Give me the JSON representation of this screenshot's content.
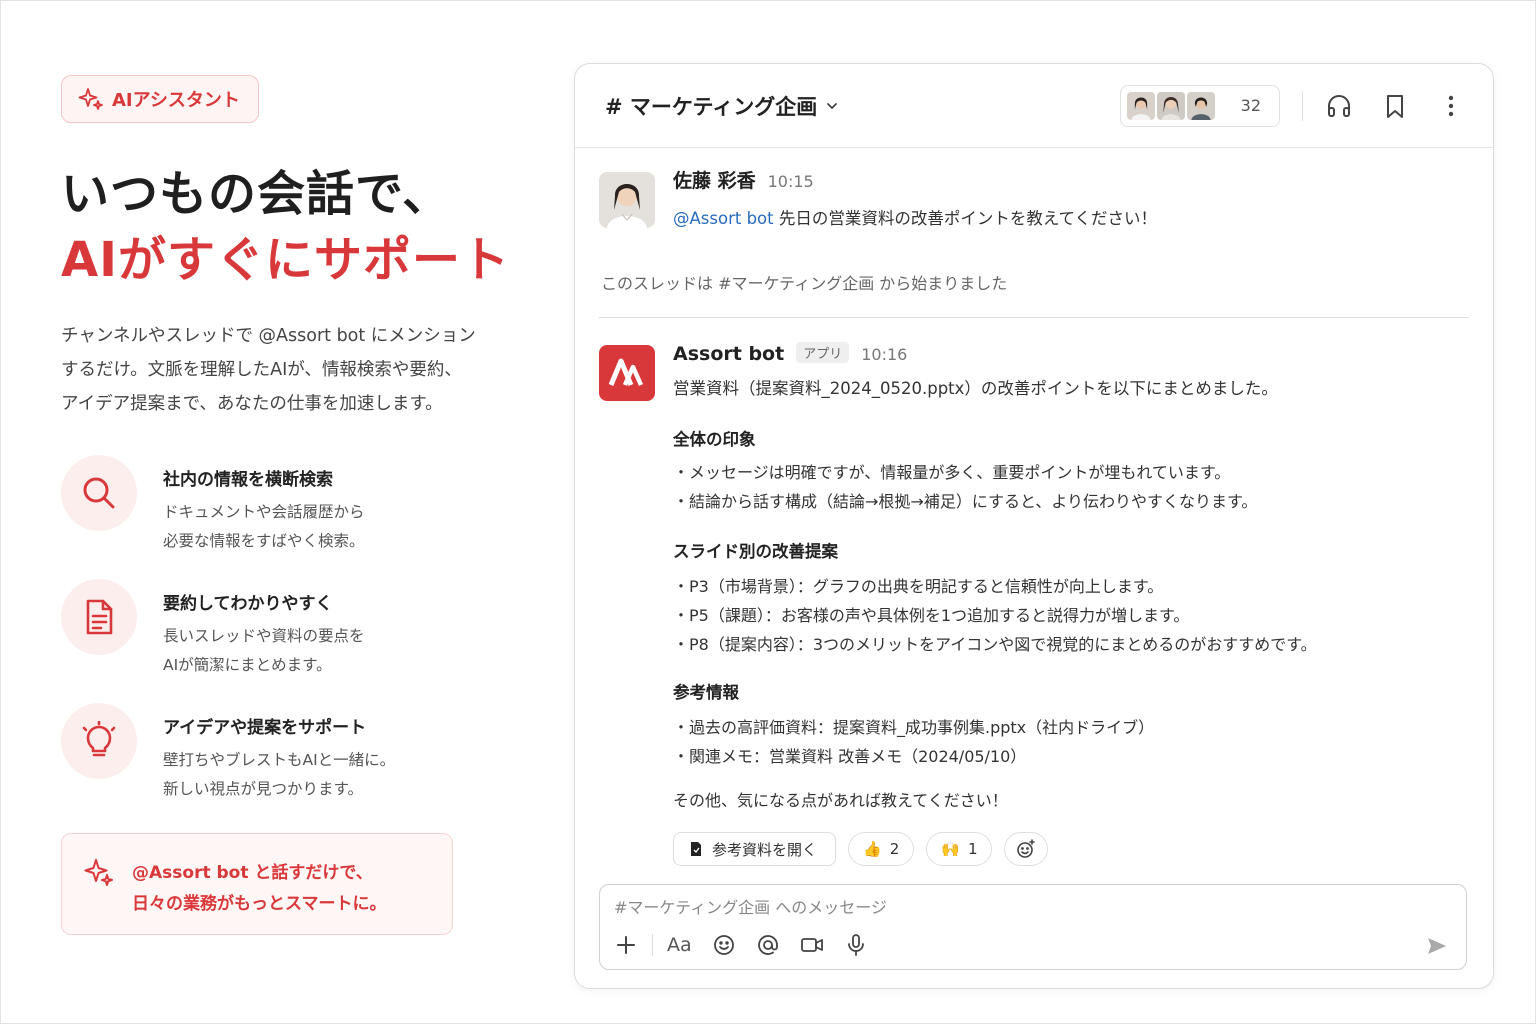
{
  "left": {
    "badge": "AIアシスタント",
    "headline_line1": "いつもの会話で、",
    "headline_line2": "AIがすぐにサポート",
    "lead_lines": [
      "チャンネルやスレッドで @Assort bot にメンション",
      "するだけ。文脈を理解したAIが、情報検索や要約、",
      "アイデア提案まで、あなたの仕事を加速します。"
    ],
    "features": [
      {
        "icon": "search-icon",
        "title": "社内の情報を横断検索",
        "desc1": "ドキュメントや会話履歴から",
        "desc2": "必要な情報をすばやく検索。"
      },
      {
        "icon": "document-icon",
        "title": "要約してわかりやすく",
        "desc1": "長いスレッドや資料の要点を",
        "desc2": "AIが簡潔にまとめます。"
      },
      {
        "icon": "lightbulb-icon",
        "title": "アイデアや提案をサポート",
        "desc1": "壁打ちやブレストもAIと一緒に。",
        "desc2": "新しい視点が見つかります。"
      }
    ],
    "callout_line1": "@Assort bot と話すだけで、",
    "callout_line2": "日々の業務がもっとスマートに。"
  },
  "chat": {
    "channel": "# マーケティング企画",
    "member_count": "32",
    "user_message": {
      "name": "佐藤 彩香",
      "time": "10:15",
      "mention": "@Assort bot",
      "text": " 先日の営業資料の改善ポイントを教えてください！"
    },
    "thread_note": "このスレッドは #マーケティング企画 から始まりました",
    "bot_message": {
      "name": "Assort bot",
      "tag": "アプリ",
      "time": "10:16",
      "intro": "営業資料（提案資料_2024_0520.pptx）の改善ポイントを以下にまとめました。",
      "section1_title": "全体の印象",
      "section1_bullets": [
        "・メッセージは明確ですが、情報量が多く、重要ポイントが埋もれています。",
        "・結論から話す構成（結論→根拠→補足）にすると、より伝わりやすくなります。"
      ],
      "section2_title": "スライド別の改善提案",
      "section2_bullets": [
        "・P3（市場背景）：グラフの出典を明記すると信頼性が向上します。",
        "・P5（課題）：お客様の声や具体例を1つ追加すると説得力が増します。",
        "・P8（提案内容）：3つのメリットをアイコンや図で視覚的にまとめるのがおすすめです。"
      ],
      "section3_title": "参考情報",
      "section3_bullets": [
        "・過去の高評価資料：提案資料_成功事例集.pptx（社内ドライブ）",
        "・関連メモ：営業資料 改善メモ（2024/05/10）"
      ],
      "closing": "その他、気になる点があれば教えてください！"
    },
    "reactions": {
      "open_doc": "参考資料を開く",
      "thumbs_emoji": "👍",
      "thumbs_count": "2",
      "raise_emoji": "🙌",
      "raise_count": "1"
    },
    "composer_placeholder": "#マーケティング企画 へのメッセージ",
    "composer_aa": "Aa"
  },
  "colors": {
    "accent": "#d9383a",
    "link": "#2a6bbd"
  }
}
